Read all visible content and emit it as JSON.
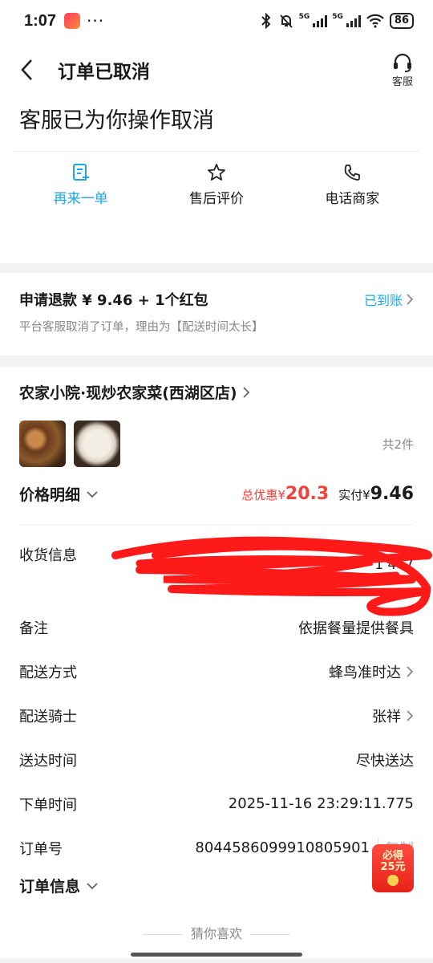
{
  "status_bar": {
    "time": "1:07",
    "dots": "···",
    "net1": "5G",
    "net2": "5G",
    "battery": "86"
  },
  "header": {
    "title": "订单已取消",
    "service_label": "客服"
  },
  "cancel_message": "客服已为你操作取消",
  "actions": [
    {
      "label": "再来一单",
      "icon": "reorder-icon"
    },
    {
      "label": "售后评价",
      "icon": "star-icon"
    },
    {
      "label": "电话商家",
      "icon": "phone-icon"
    }
  ],
  "refund": {
    "amount_text": "申请退款 ¥ 9.46 + 1个红包",
    "status": "已到账",
    "reason": "平台客服取消了订单，理由为【配送时间太长】"
  },
  "shop": {
    "name": "农家小院·现炒农家菜(西湖区店)"
  },
  "items": {
    "count_text": "共2件"
  },
  "price": {
    "detail_label": "价格明细",
    "discount_label": "总优惠¥",
    "discount_value": "20.3",
    "paid_label": "实付¥",
    "paid_value": "9.46"
  },
  "info": {
    "address_label": "收货信息",
    "address_lines": [
      "",
      "",
      "1 467"
    ],
    "note_label": "备注",
    "note_value": "依据餐量提供餐具",
    "delivery_label": "配送方式",
    "delivery_value": "蜂鸟准时达",
    "rider_label": "配送骑士",
    "rider_value": "张祥",
    "arrival_label": "送达时间",
    "arrival_value": "尽快送达",
    "order_time_label": "下单时间",
    "order_time_value": "2025-11-16 23:29:11.775",
    "order_no_label": "订单号",
    "order_no_value": "8044586099910805901",
    "copy_label": "复制"
  },
  "order_info_label": "订单信息",
  "redpack": {
    "line1": "必得",
    "line2": "25元"
  },
  "guess_label": "猜你喜欢"
}
